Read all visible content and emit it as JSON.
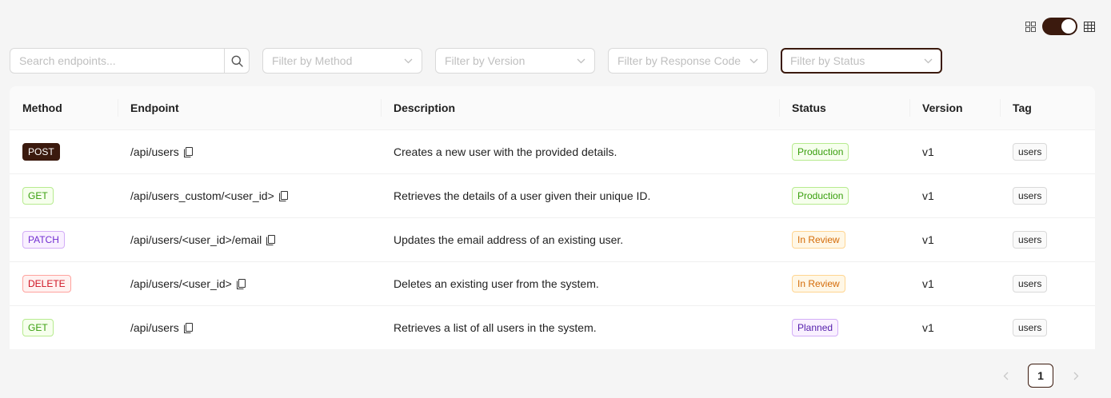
{
  "colors": {
    "accent": "#3b1a0e",
    "production": {
      "fg": "#389e0d",
      "bg": "#f6ffed",
      "border": "#b7eb8f"
    },
    "in_review": {
      "fg": "#d46b08",
      "bg": "#fff7e6",
      "border": "#ffd591"
    },
    "planned": {
      "fg": "#531dab",
      "bg": "#f9f0ff",
      "border": "#d3adf7"
    },
    "users_tag": {
      "fg": "#1f1f1f",
      "bg": "#fafafa",
      "border": "#d9d9d9"
    }
  },
  "view_toggle": {
    "left_icon": "grid-icon",
    "right_icon": "table-icon",
    "state": "table"
  },
  "filters": {
    "search_placeholder": "Search endpoints...",
    "search_icon": "search-icon",
    "method_placeholder": "Filter by Method",
    "version_placeholder": "Filter by Version",
    "response_code_placeholder": "Filter by Response Code",
    "status_placeholder": "Filter by Status"
  },
  "table": {
    "headers": {
      "method": "Method",
      "endpoint": "Endpoint",
      "description": "Description",
      "status": "Status",
      "version": "Version",
      "tag": "Tag"
    },
    "rows": [
      {
        "method": "POST",
        "method_style": {
          "fg": "#ffffff",
          "bg": "#3b1a0e",
          "border": "#3b1a0e"
        },
        "endpoint": "/api/users",
        "description": "Creates a new user with the provided details.",
        "status": "Production",
        "status_key": "production",
        "version": "v1",
        "tag": "users"
      },
      {
        "method": "GET",
        "method_style": {
          "fg": "#389e0d",
          "bg": "#f6ffed",
          "border": "#b7eb8f"
        },
        "endpoint": "/api/users_custom/<user_id>",
        "description": "Retrieves the details of a user given their unique ID.",
        "status": "Production",
        "status_key": "production",
        "version": "v1",
        "tag": "users"
      },
      {
        "method": "PATCH",
        "method_style": {
          "fg": "#722ed1",
          "bg": "#f9f0ff",
          "border": "#d3adf7"
        },
        "endpoint": "/api/users/<user_id>/email",
        "description": "Updates the email address of an existing user.",
        "status": "In Review",
        "status_key": "in_review",
        "version": "v1",
        "tag": "users"
      },
      {
        "method": "DELETE",
        "method_style": {
          "fg": "#cf1322",
          "bg": "#fff1f0",
          "border": "#ffa39e"
        },
        "endpoint": "/api/users/<user_id>",
        "description": "Deletes an existing user from the system.",
        "status": "In Review",
        "status_key": "in_review",
        "version": "v1",
        "tag": "users"
      },
      {
        "method": "GET",
        "method_style": {
          "fg": "#389e0d",
          "bg": "#f6ffed",
          "border": "#b7eb8f"
        },
        "endpoint": "/api/users",
        "description": "Retrieves a list of all users in the system.",
        "status": "Planned",
        "status_key": "planned",
        "version": "v1",
        "tag": "users"
      }
    ]
  },
  "pagination": {
    "current_page": "1",
    "prev_icon": "chevron-left-icon",
    "next_icon": "chevron-right-icon"
  }
}
